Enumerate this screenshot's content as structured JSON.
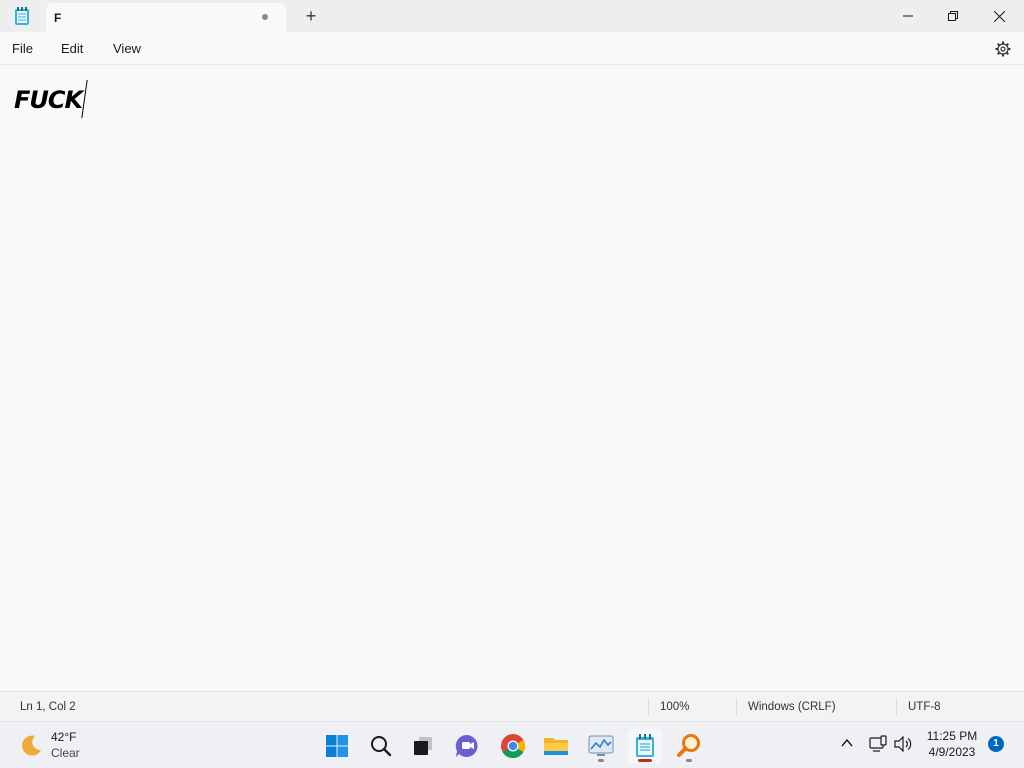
{
  "window": {
    "tab_title": "F",
    "new_tab_symbol": "+",
    "controls": {
      "minimize": "minimize-icon",
      "maximize": "restore-icon",
      "close": "close-icon"
    }
  },
  "menu": {
    "items": [
      "File",
      "Edit",
      "View"
    ],
    "settings_icon": "gear-icon"
  },
  "editor": {
    "content": "FUCK"
  },
  "status": {
    "position": "Ln 1, Col 2",
    "zoom": "100%",
    "line_ending": "Windows (CRLF)",
    "encoding": "UTF-8"
  },
  "taskbar": {
    "weather": {
      "temperature": "42°F",
      "condition": "Clear",
      "icon": "moon-icon"
    },
    "apps": [
      {
        "name": "start-button",
        "icon": "windows-logo-icon"
      },
      {
        "name": "search-button",
        "icon": "search-icon"
      },
      {
        "name": "task-view-button",
        "icon": "task-view-icon"
      },
      {
        "name": "chat-button",
        "icon": "chat-icon"
      },
      {
        "name": "chrome-button",
        "icon": "chrome-icon"
      },
      {
        "name": "file-explorer-button",
        "icon": "folder-icon"
      },
      {
        "name": "task-manager-button",
        "icon": "monitor-chart-icon"
      },
      {
        "name": "notepad-button",
        "icon": "notepad-icon",
        "active": true
      },
      {
        "name": "magnifier-button",
        "icon": "magnifier-icon"
      }
    ],
    "clock": {
      "time": "11:25 PM",
      "date": "4/9/2023"
    },
    "notification_count": "1"
  },
  "colors": {
    "accent": "#0067c0",
    "active_indicator": "#c42b1c",
    "background": "#f9f9f9"
  }
}
